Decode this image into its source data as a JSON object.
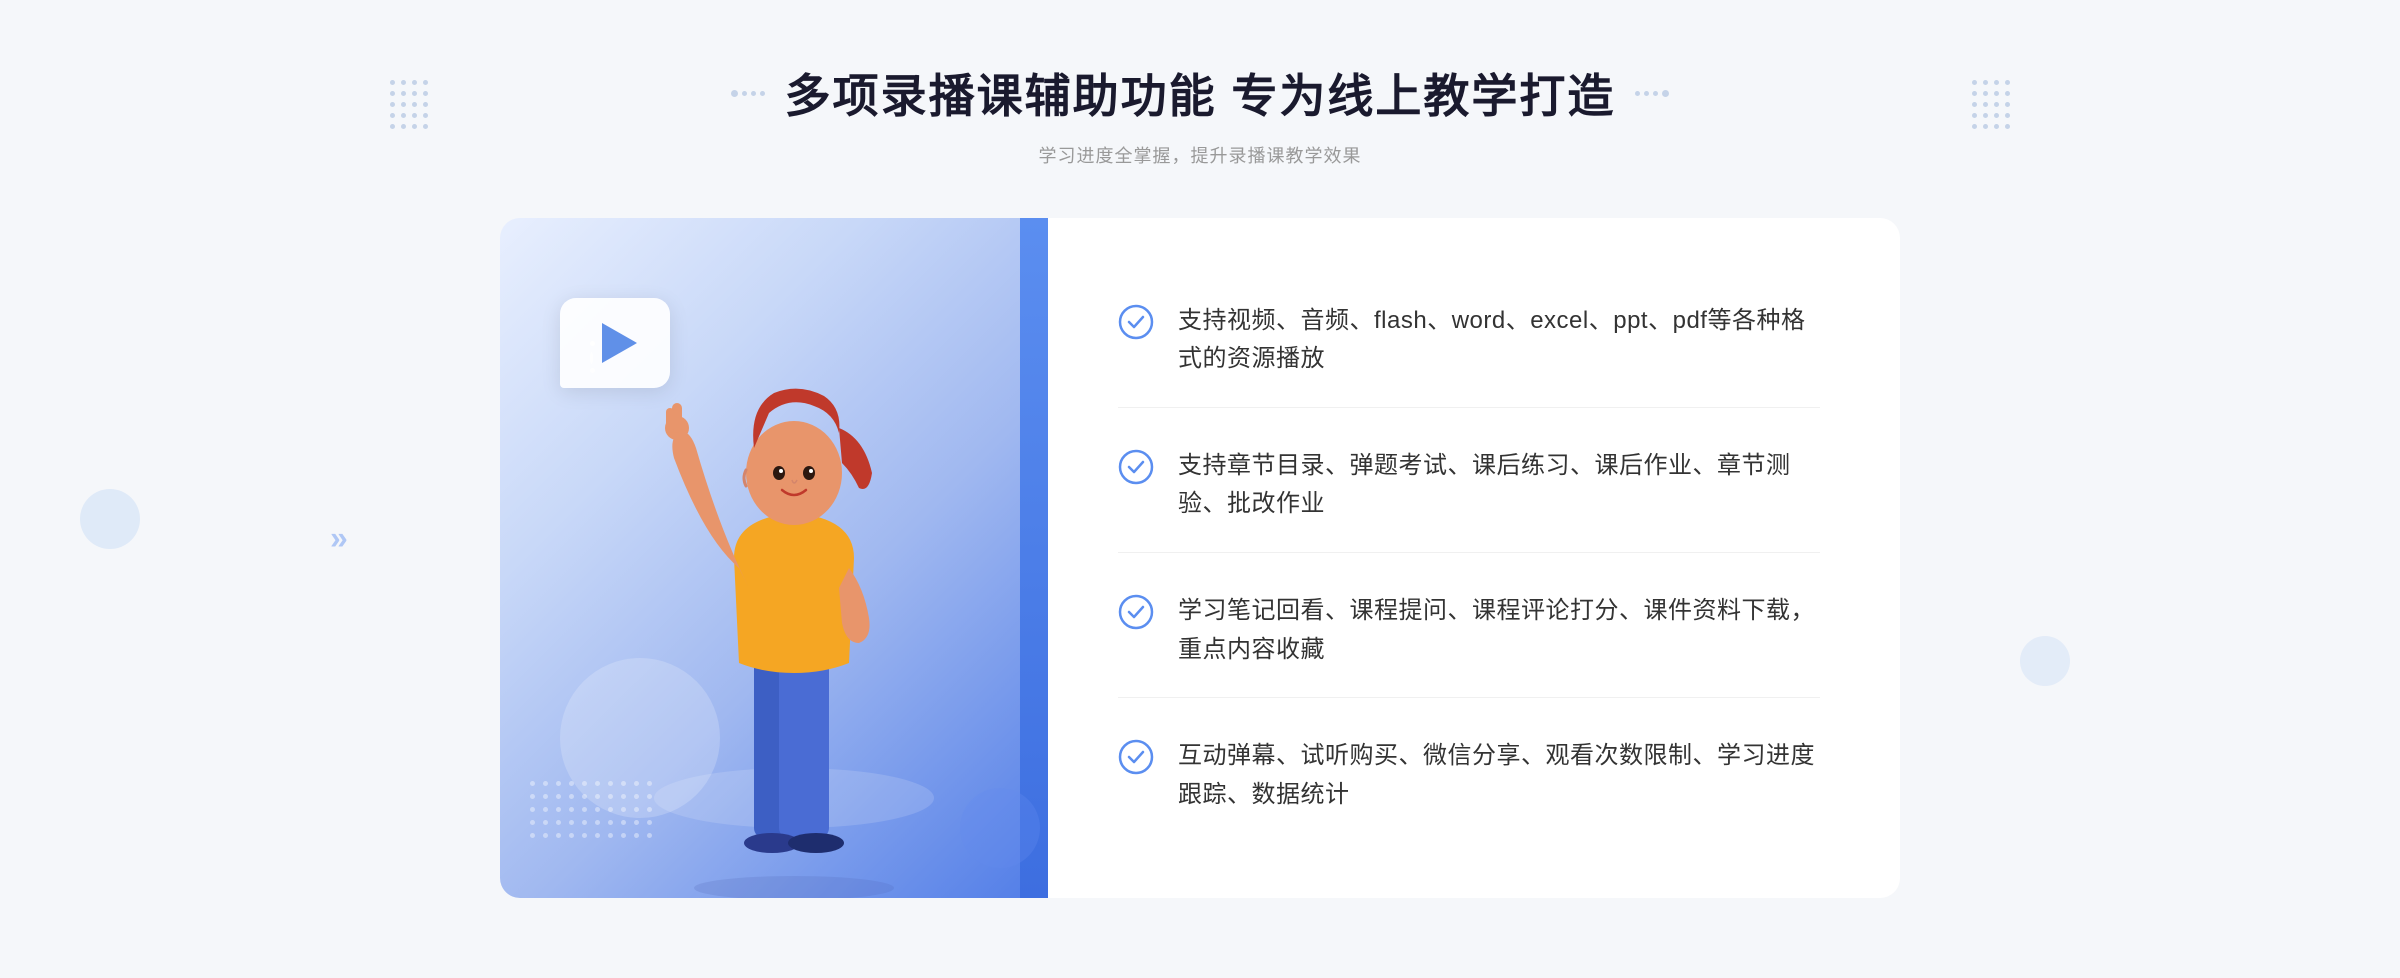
{
  "header": {
    "main_title": "多项录播课辅助功能 专为线上教学打造",
    "sub_title": "学习进度全掌握，提升录播课教学效果"
  },
  "features": [
    {
      "id": 1,
      "text": "支持视频、音频、flash、word、excel、ppt、pdf等各种格式的资源播放"
    },
    {
      "id": 2,
      "text": "支持章节目录、弹题考试、课后练习、课后作业、章节测验、批改作业"
    },
    {
      "id": 3,
      "text": "学习笔记回看、课程提问、课程评论打分、课件资料下载，重点内容收藏"
    },
    {
      "id": 4,
      "text": "互动弹幕、试听购买、微信分享、观看次数限制、学习进度跟踪、数据统计"
    }
  ],
  "colors": {
    "primary_blue": "#5b8ef0",
    "light_blue": "#c8d8f8",
    "check_color": "#5b8ef0",
    "text_dark": "#333333",
    "text_gray": "#999999"
  }
}
